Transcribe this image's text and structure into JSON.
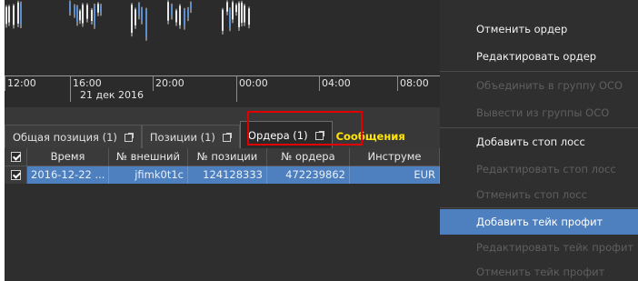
{
  "chart": {
    "time_ticks": [
      "12:00",
      "16:00",
      "20:00",
      "00:00",
      "04:00",
      "08:00"
    ],
    "date_label": "21 дек 2016"
  },
  "tabs": [
    {
      "label": "Общая позиция (1)",
      "icon": "popout-icon",
      "active": false
    },
    {
      "label": "Позиции (1)",
      "icon": "popout-icon",
      "active": false
    },
    {
      "label": "Ордера (1)",
      "icon": "popout-icon",
      "active": true
    },
    {
      "label": "Сообщения",
      "icon": null,
      "active": false
    }
  ],
  "table": {
    "columns": [
      "Время",
      "№ внешний",
      "№ позиции",
      "№ ордера",
      "Инструме"
    ],
    "header_checkbox": true,
    "rows": [
      {
        "checked": true,
        "cells": [
          "2016-12-22 ...",
          "jfimk0t1c",
          "124128333",
          "472239862",
          "EUR"
        ]
      }
    ]
  },
  "context_menu": {
    "items": [
      {
        "label": "Отменить ордер",
        "enabled": true,
        "selected": false
      },
      {
        "label": "Редактировать ордер",
        "enabled": true,
        "selected": false
      },
      {
        "label": "Объединить в группу ОСО",
        "enabled": false,
        "selected": false
      },
      {
        "label": "Вывести из группы ОСО",
        "enabled": false,
        "selected": false
      },
      {
        "label": "Добавить стоп лосс",
        "enabled": true,
        "selected": false
      },
      {
        "label": "Редактировать стоп лосс",
        "enabled": false,
        "selected": false
      },
      {
        "label": "Отменить стоп лосс",
        "enabled": false,
        "selected": false
      },
      {
        "label": "Добавить тейк профит",
        "enabled": true,
        "selected": true
      },
      {
        "label": "Редактировать тейк профит",
        "enabled": false,
        "selected": false
      },
      {
        "label": "Отменить тейк профит",
        "enabled": false,
        "selected": false
      }
    ]
  },
  "colors": {
    "selection": "#4e80bf",
    "highlight_tab_text": "#ffe600",
    "annotation_box": "#e00000",
    "background": "#2f2f2f"
  }
}
